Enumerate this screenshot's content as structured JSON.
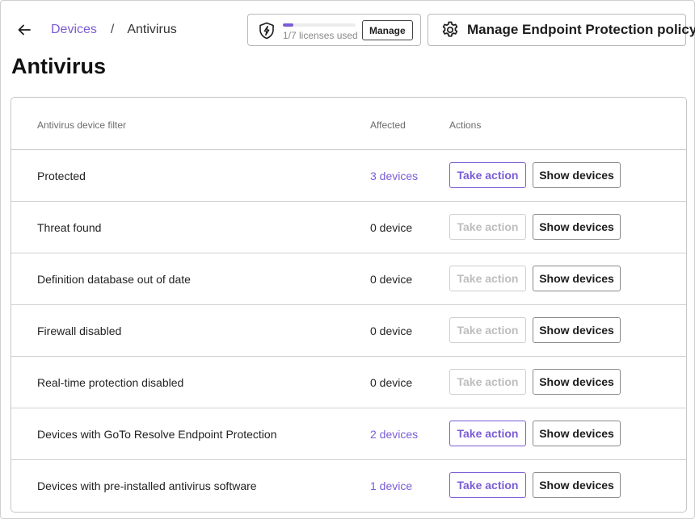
{
  "header": {
    "breadcrumb": {
      "parent": "Devices",
      "separator": "/",
      "current": "Antivirus"
    },
    "licenses": {
      "text": "1/7 licenses used",
      "used": 1,
      "total": 7,
      "manage_label": "Manage"
    },
    "policy_button_label": "Manage Endpoint Protection policy"
  },
  "page_title": "Antivirus",
  "table": {
    "columns": {
      "filter": "Antivirus device filter",
      "affected": "Affected",
      "actions": "Actions"
    },
    "rows": [
      {
        "name": "Protected",
        "affected": "3 devices",
        "affected_link": true,
        "take_action": "Take action",
        "take_action_enabled": true,
        "show_devices": "Show devices"
      },
      {
        "name": "Threat found",
        "affected": "0 device",
        "affected_link": false,
        "take_action": "Take action",
        "take_action_enabled": false,
        "show_devices": "Show devices"
      },
      {
        "name": "Definition database out of date",
        "affected": "0 device",
        "affected_link": false,
        "take_action": "Take action",
        "take_action_enabled": false,
        "show_devices": "Show devices"
      },
      {
        "name": "Firewall disabled",
        "affected": "0 device",
        "affected_link": false,
        "take_action": "Take action",
        "take_action_enabled": false,
        "show_devices": "Show devices"
      },
      {
        "name": "Real-time protection disabled",
        "affected": "0 device",
        "affected_link": false,
        "take_action": "Take action",
        "take_action_enabled": false,
        "show_devices": "Show devices"
      },
      {
        "name": "Devices with GoTo Resolve Endpoint Protection",
        "affected": "2 devices",
        "affected_link": true,
        "take_action": "Take action",
        "take_action_enabled": true,
        "show_devices": "Show devices"
      },
      {
        "name": "Devices with pre-installed antivirus software",
        "affected": "1 device",
        "affected_link": true,
        "take_action": "Take action",
        "take_action_enabled": true,
        "show_devices": "Show devices"
      }
    ]
  },
  "colors": {
    "accent": "#7a5cd6",
    "border": "#c6c6c6",
    "muted_text": "#8a8a8a",
    "disabled_text": "#bdbdbd"
  },
  "icons": {
    "back": "arrow-left-icon",
    "license": "shield-lightning-icon",
    "policy": "gear-icon"
  }
}
